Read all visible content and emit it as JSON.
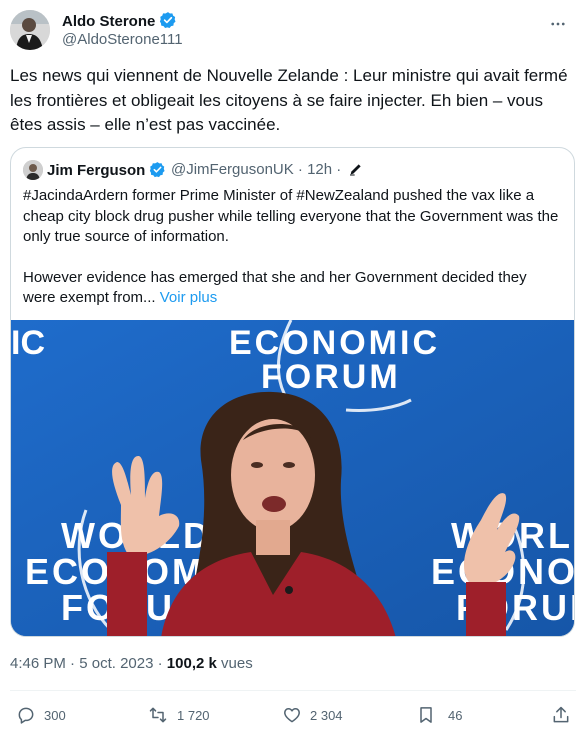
{
  "author": {
    "name": "Aldo Sterone",
    "handle": "@AldoSterone111"
  },
  "tweet": {
    "text": "Les news qui viennent de Nouvelle Zelande : Leur ministre qui avait fermé les frontières et obligeait les citoyens à se faire injecter. Eh bien – vous êtes assis – elle n’est pas vaccinée."
  },
  "quote": {
    "name": "Jim Ferguson",
    "meta": "@JimFergusonUK · 12h ·",
    "text1": "#JacindaArdern former Prime Minister of #NewZealand pushed the vax like a cheap city block drug pusher while telling everyone that the Government was the only true source of information.",
    "text2": "However evidence has emerged that she and her Government decided they were exempt from...",
    "see_more": "Voir plus",
    "media": {
      "line_ic": "IC",
      "line_economic": "ECONOMIC",
      "line_forum": "FORUM",
      "left_world": "WORLD",
      "left_economic": "ECONOMIC",
      "left_forum": "FORUM",
      "right_world": "WORLD",
      "right_economic": "ECONOMIC",
      "right_forum": "FORUM"
    }
  },
  "meta": {
    "time": "4:46 PM",
    "date": "5 oct. 2023",
    "views_count": "100,2 k",
    "views_label": "vues",
    "separator": "·"
  },
  "actions": {
    "replies": "300",
    "reposts": "1 720",
    "likes": "2 304",
    "bookmarks": "46"
  },
  "colors": {
    "accent": "#1d9bf0",
    "muted": "#536471",
    "border": "#cfd9de"
  },
  "icons": [
    "verified-badge-icon",
    "more-icon",
    "edit-icon",
    "reply-icon",
    "repost-icon",
    "like-icon",
    "bookmark-icon",
    "share-icon"
  ]
}
